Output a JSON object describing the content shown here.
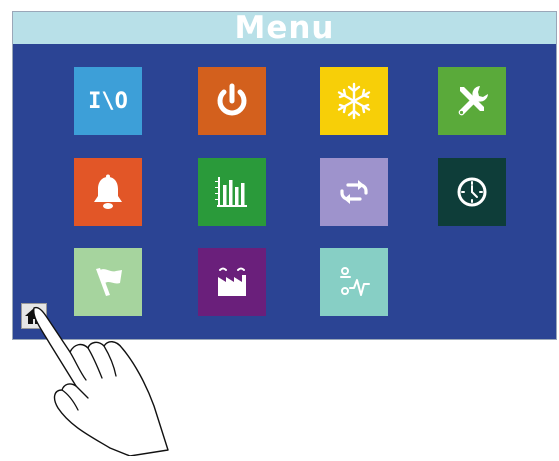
{
  "title": "Menu",
  "colors": {
    "screen_bg": "#2b4494",
    "title_bar": "#b8e0e8"
  },
  "tiles": [
    {
      "icon": "io-icon",
      "label": "I\\O",
      "color": "#3d9fd8"
    },
    {
      "icon": "power-icon",
      "color": "#d3601d"
    },
    {
      "icon": "snowflake-icon",
      "color": "#f7cf08"
    },
    {
      "icon": "tools-icon",
      "color": "#5aaa3a"
    },
    {
      "icon": "alarm-bell-icon",
      "color": "#e25627"
    },
    {
      "icon": "bar-chart-icon",
      "color": "#2a9a3a"
    },
    {
      "icon": "cycle-arrows-icon",
      "color": "#9e93cc"
    },
    {
      "icon": "clock-icon",
      "color": "#0e3d39"
    },
    {
      "icon": "flag-icon",
      "color": "#a6d49e"
    },
    {
      "icon": "factory-icon",
      "color": "#6a1f7b"
    },
    {
      "icon": "sensor-wave-icon",
      "color": "#87cfc5"
    }
  ],
  "home_button": {
    "icon": "home-icon"
  }
}
